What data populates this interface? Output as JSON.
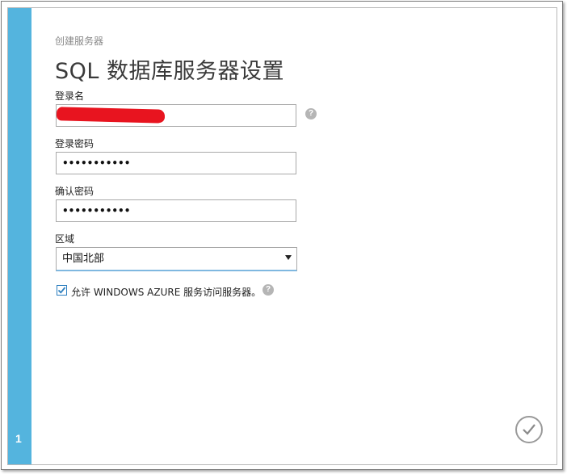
{
  "wizard": {
    "breadcrumb": "创建服务器",
    "title": "SQL 数据库服务器设置",
    "step_number": "1"
  },
  "form": {
    "login_name": {
      "label": "登录名",
      "value": ""
    },
    "login_password": {
      "label": "登录密码",
      "value": "•••••••••••"
    },
    "confirm_password": {
      "label": "确认密码",
      "value": "•••••••••••"
    },
    "region": {
      "label": "区域",
      "selected": "中国北部"
    },
    "allow_azure": {
      "label": "允许 WINDOWS AZURE 服务访问服务器。",
      "checked": true
    }
  },
  "icons": {
    "help": "?",
    "confirm": "checkmark-icon",
    "dropdown": "triangle-down-icon"
  },
  "colors": {
    "sidebar": "#54b4de",
    "redaction": "#e8141f",
    "checkbox_accent": "#2d7fbf"
  }
}
